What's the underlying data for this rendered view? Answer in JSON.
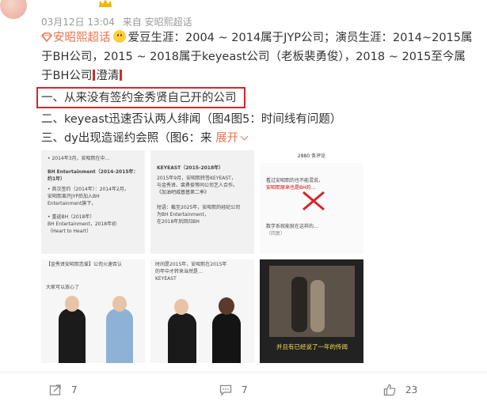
{
  "meta": {
    "date": "03月12日 13:04",
    "source_prefix": "来自",
    "source": "安昭熙超话"
  },
  "post": {
    "supertopic": "安昭熙超话",
    "p1_a": "爱豆生涯：2004 ~ 2014属于JYP公司；演员生涯：2014~2015属于BH公司，2015 ~ 2018属于keyeast公司（老板裴勇俊），2018 ~ 2015至今属于BH公司",
    "p1_b": "澄清",
    "line1": "一、从来没有签约金秀贤自己开的公司",
    "line2": "二、keyeast迅速否认两人绯闻（图4图5：时间线有问题）",
    "line3": "三、dy出现造谣约会照（图6：来",
    "expand": "展开"
  },
  "images": {
    "t1_text": [
      "• 2014年3月，安昭熙在中...",
      "BH Entertainment（2014-2015年：",
      "约1年）",
      "• 首次签约（2014年）：2014年2月，",
      "安昭熙离开JYP后加入BH",
      "Entertainment旗下，",
      "• 重返BH（2018年）",
      "BH Entertainment，2018年初",
      "（Heart to Heart）"
    ],
    "t2_text": [
      "KEYEAST（2015-2018年）",
      "2015年9月，安昭熙转签KEYEAST，",
      "与金秀贤、裴勇俊等同公司艺人合作。",
      "《加油吧威基基第二季》",
      "短语：截至2025年，安昭熙的经纪公司",
      "为BH Entertainment，",
      "在2018年后回归BH"
    ],
    "t3_text": [
      "2880 条评论",
      "看过安昭熙的也不能混说，",
      "安昭熙原来也是BH的…",
      "数学系就能就在这样的…",
      "（回复）"
    ],
    "t4_text": [
      "【金秀贤安昭熙恋爱】公司火速否认",
      "大家可以放心了"
    ],
    "t5_text": [
      "时间是2015年，安昭熙在2015年",
      "的年中才转来当然是…",
      "KEYEAST"
    ],
    "t6_text": [
      "并且有已经说了一年的传闻"
    ]
  },
  "actions": {
    "share": "7",
    "comment": "7",
    "like": "23"
  },
  "colors": {
    "accent": "#eb7350",
    "highlight_box": "#d9252a"
  },
  "icons": [
    "crown-icon",
    "diamond-icon",
    "smile-emoji-icon",
    "chevron-down-icon",
    "share-icon",
    "comment-icon",
    "like-icon"
  ]
}
